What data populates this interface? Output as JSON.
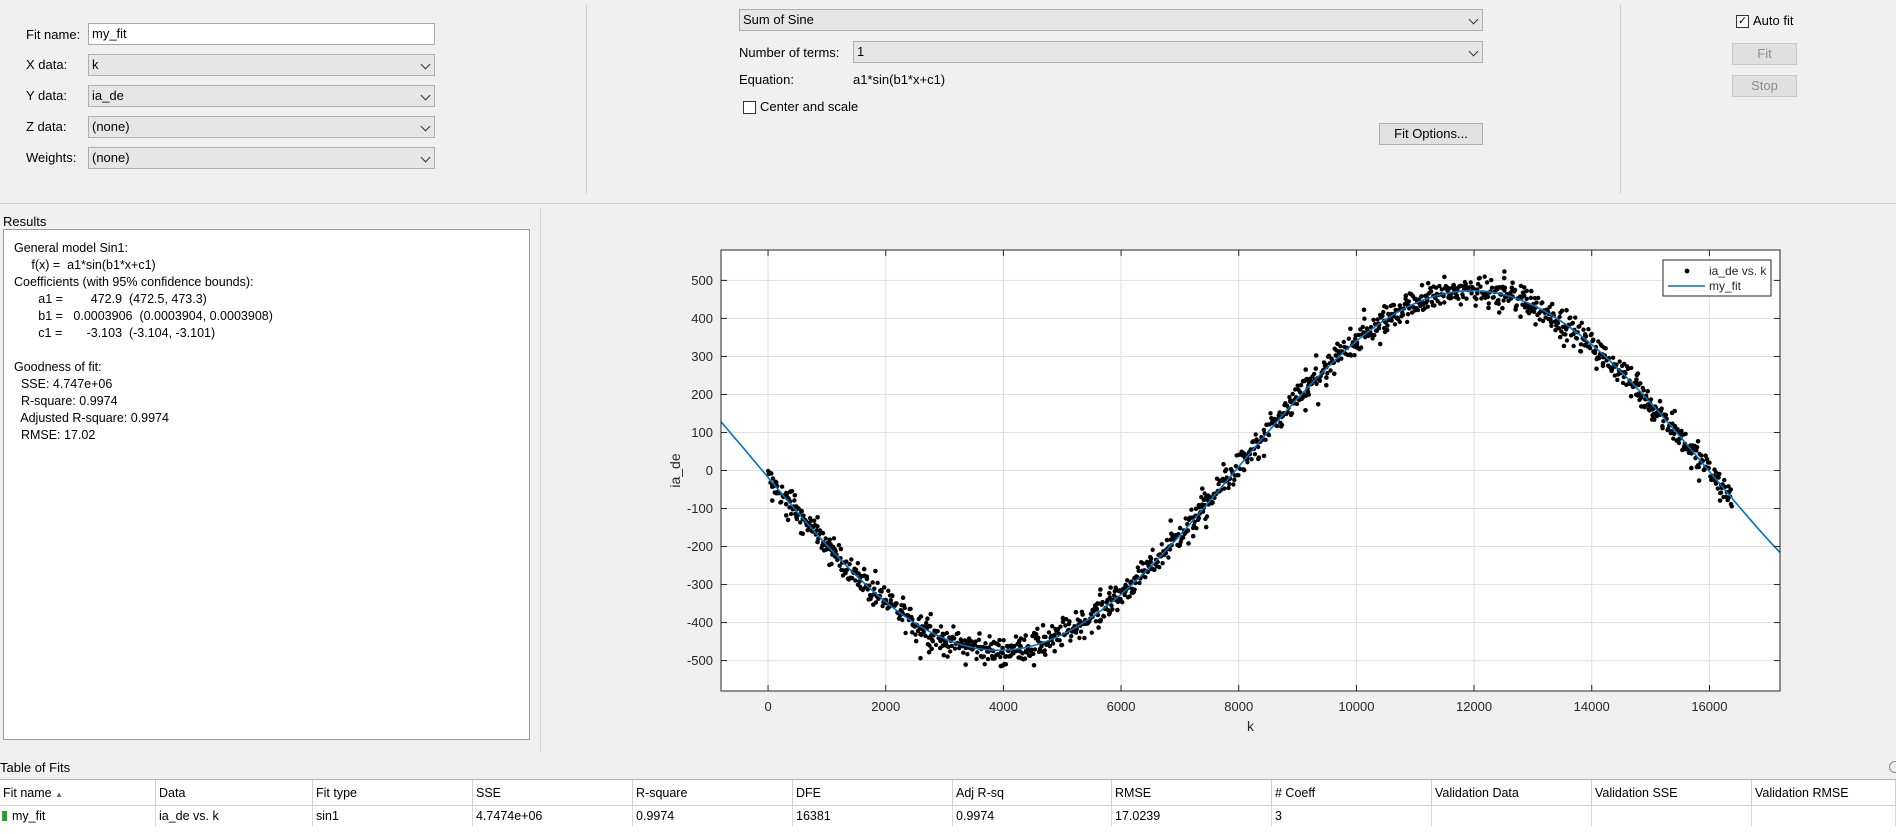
{
  "data_selection": {
    "fit_name_label": "Fit name:",
    "fit_name_value": "my_fit",
    "x_label": "X data:",
    "x_value": "k",
    "y_label": "Y data:",
    "y_value": "ia_de",
    "z_label": "Z data:",
    "z_value": "(none)",
    "weights_label": "Weights:",
    "weights_value": "(none)"
  },
  "fit_type": {
    "type_value": "Sum of Sine",
    "terms_label": "Number of terms:",
    "terms_value": "1",
    "equation_label": "Equation:",
    "equation_value": "a1*sin(b1*x+c1)",
    "center_scale_label": "Center and scale",
    "center_scale_checked": false,
    "fit_options_label": "Fit Options..."
  },
  "actions": {
    "auto_fit_label": "Auto fit",
    "auto_fit_checked": true,
    "fit_label": "Fit",
    "stop_label": "Stop"
  },
  "results": {
    "title": "Results",
    "lines": [
      "General model Sin1:",
      "     f(x) =  a1*sin(b1*x+c1)",
      "Coefficients (with 95% confidence bounds):",
      "       a1 =        472.9  (472.5, 473.3)",
      "       b1 =   0.0003906  (0.0003904, 0.0003908)",
      "       c1 =       -3.103  (-3.104, -3.101)",
      "",
      "Goodness of fit:",
      "  SSE: 4.747e+06",
      "  R-square: 0.9974",
      "  Adjusted R-square: 0.9974",
      "  RMSE: 17.02"
    ]
  },
  "chart_data": {
    "type": "scatter",
    "xlabel": "k",
    "ylabel": "ia_de",
    "xlim": [
      -800,
      17200
    ],
    "ylim": [
      -580,
      580
    ],
    "xticks": [
      0,
      2000,
      4000,
      6000,
      8000,
      10000,
      12000,
      14000,
      16000
    ],
    "xtick_labels": [
      "0",
      "2000",
      "4000",
      "6000",
      "8000",
      "10000",
      "12000",
      "14000",
      "16000"
    ],
    "yticks": [
      -500,
      -400,
      -300,
      -200,
      -100,
      0,
      100,
      200,
      300,
      400,
      500
    ],
    "ytick_labels": [
      "-500",
      "-400",
      "-300",
      "-200",
      "-100",
      "0",
      "100",
      "200",
      "300",
      "400",
      "500"
    ],
    "grid": true,
    "legend_position": "top-right",
    "series": [
      {
        "name": "ia_de vs. k",
        "kind": "points",
        "color": "#000000",
        "x_range": [
          0,
          16384
        ],
        "noise": 17.02
      },
      {
        "name": "my_fit",
        "kind": "line",
        "color": "#0072bd",
        "model": "a1*sin(b1*x+c1)",
        "a1": 472.9,
        "b1": 0.0003906,
        "c1": -3.103
      }
    ]
  },
  "table_of_fits": {
    "title": "Table of Fits",
    "columns": [
      "Fit name",
      "Data",
      "Fit type",
      "SSE",
      "R-square",
      "DFE",
      "Adj R-sq",
      "RMSE",
      "# Coeff",
      "Validation Data",
      "Validation SSE",
      "Validation RMSE"
    ],
    "rows": [
      [
        "my_fit",
        "ia_de vs. k",
        "sin1",
        "4.7474e+06",
        "0.9974",
        "16381",
        "0.9974",
        "17.0239",
        "3",
        "",
        "",
        ""
      ]
    ],
    "status_color": "#2ca02c"
  }
}
